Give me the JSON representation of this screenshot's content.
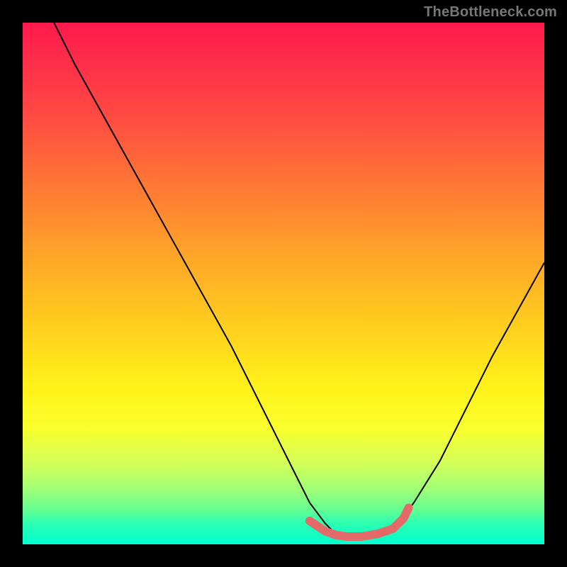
{
  "watermark": "TheBottleneck.com",
  "chart_data": {
    "type": "line",
    "title": "",
    "xlabel": "",
    "ylabel": "",
    "xlim": [
      0,
      100
    ],
    "ylim": [
      0,
      100
    ],
    "series": [
      {
        "name": "curve",
        "color": "#000000",
        "stroke_width": 2,
        "x": [
          6,
          10,
          20,
          30,
          40,
          48,
          52,
          55,
          58,
          60,
          62,
          65,
          68,
          72,
          75,
          80,
          85,
          90,
          95,
          100
        ],
        "y": [
          100,
          92,
          74,
          56,
          38,
          22,
          14,
          8,
          4,
          2,
          1.5,
          1.5,
          2,
          4,
          8,
          16,
          26,
          36,
          45,
          54
        ]
      }
    ],
    "highlight_segment": {
      "name": "bottom-highlight",
      "color": "#e46a6a",
      "stroke_width": 12,
      "linecap": "round",
      "x": [
        55,
        58,
        60,
        62,
        65,
        68,
        71,
        73,
        74
      ],
      "y": [
        4.5,
        2.5,
        1.8,
        1.5,
        1.5,
        2,
        3,
        5,
        7
      ]
    }
  }
}
